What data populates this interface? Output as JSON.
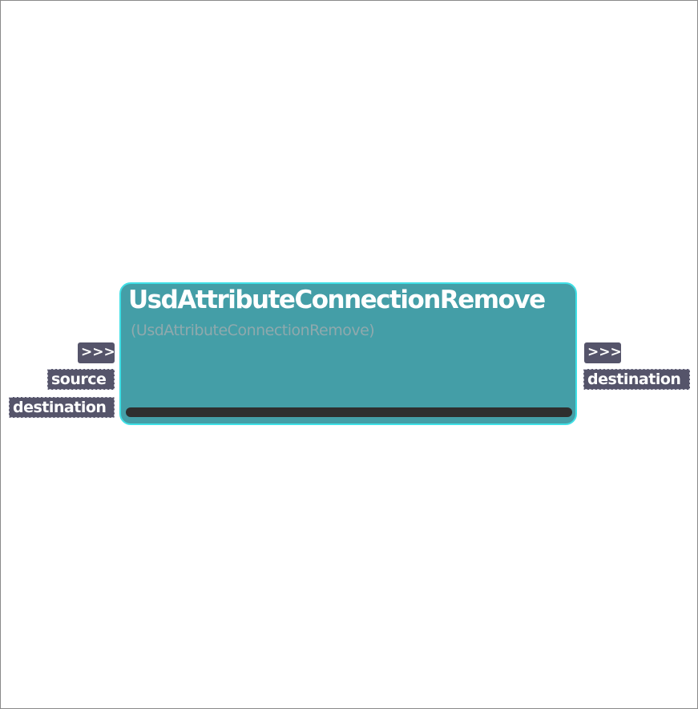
{
  "node": {
    "title": "UsdAttributeConnectionRemove",
    "subtitle": "(UsdAttributeConnectionRemove)"
  },
  "inputs": [
    {
      "label": ">>>",
      "kind": "exec"
    },
    {
      "label": "source",
      "kind": "data"
    },
    {
      "label": "destination",
      "kind": "data"
    }
  ],
  "outputs": [
    {
      "label": ">>>",
      "kind": "exec"
    },
    {
      "label": "destination",
      "kind": "data"
    }
  ],
  "colors": {
    "node_fill": "#449ea7",
    "node_border": "#3fe0e6",
    "pin_fill": "#55546a",
    "bar": "#2e2e2e"
  }
}
